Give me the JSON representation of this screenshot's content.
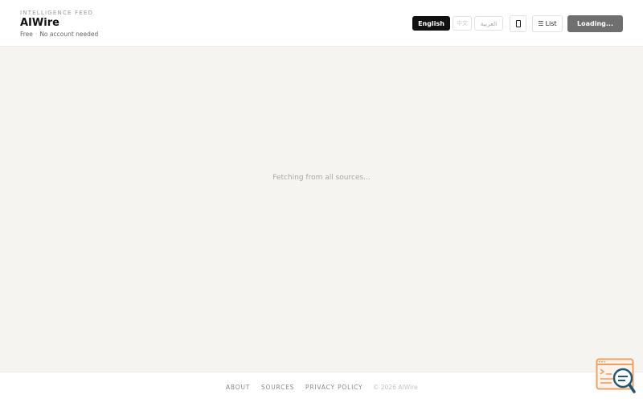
{
  "header": {
    "eyebrow": "INTELLIGENCE FEED",
    "title": "AIWire",
    "tagline_free": "Free",
    "tagline_separator": "·",
    "tagline_account": "No account needed"
  },
  "language_selector": {
    "english": "English",
    "chinese": "中文",
    "arabic": "العربية"
  },
  "toolbar": {
    "device_icon": "phone-icon",
    "list_icon_glyph": "☰",
    "list_label": "List",
    "loading_label": "Loading..."
  },
  "main": {
    "status": "Fetching from all sources..."
  },
  "footer": {
    "about": "ABOUT",
    "sources": "SOURCES",
    "privacy": "PRIVACY POLICY",
    "copyright": "© 2026 AIWire"
  },
  "colors": {
    "primary": "#111111",
    "loading_button": "#6f6f6f",
    "background": "#f5f4f1",
    "widget_accent": "#f0a060",
    "widget_icon": "#1e5a78"
  },
  "widget": {
    "icon": "search-analytics-icon"
  }
}
